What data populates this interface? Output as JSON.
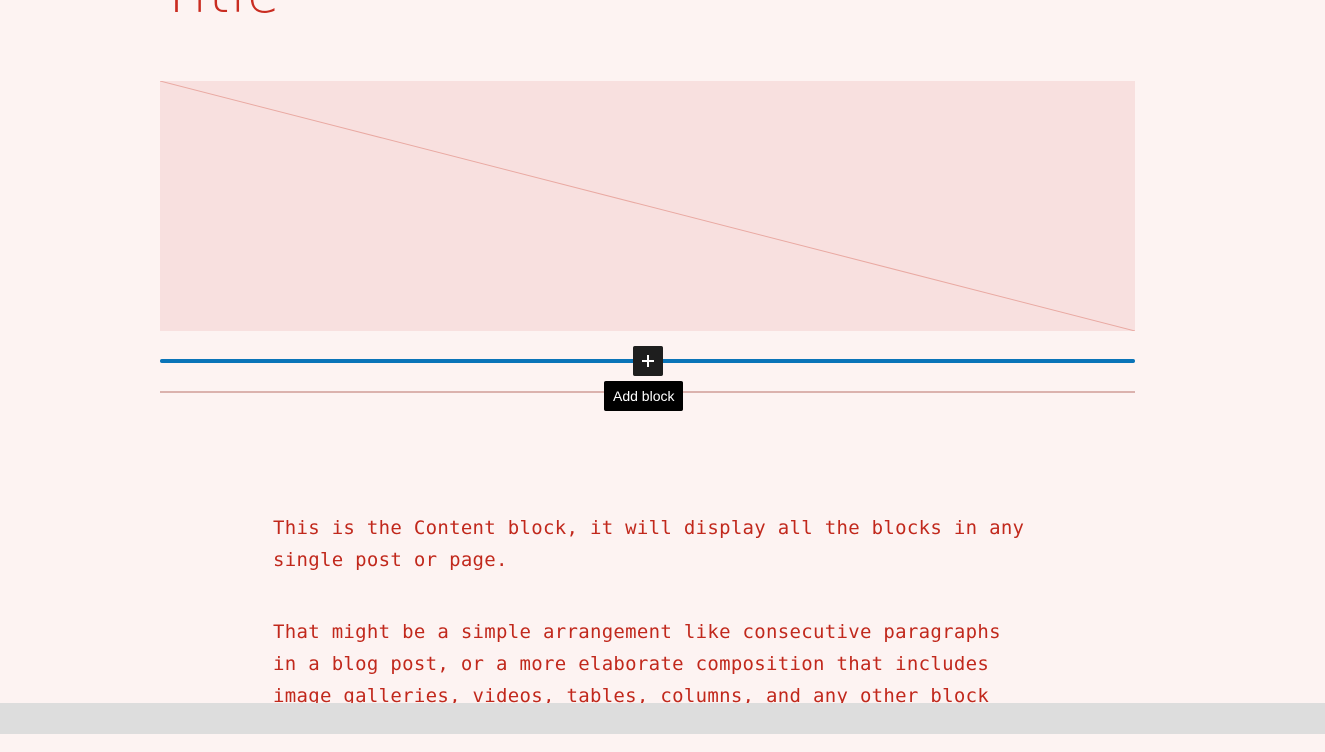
{
  "post": {
    "title": "Title"
  },
  "featured_image": {
    "placeholder": "image-placeholder"
  },
  "inserter": {
    "add_icon": "plus-icon",
    "tooltip": "Add block"
  },
  "content": {
    "paragraphs": [
      "This is the Content block, it will display all the blocks in any single post or page.",
      "That might be a simple arrangement like consecutive paragraphs in a blog post, or a more elaborate composition that includes image galleries, videos, tables, columns, and any other block"
    ]
  },
  "colors": {
    "background": "#fdf3f2",
    "text": "#c1281c",
    "inserter_line": "#0a74b8",
    "placeholder_bg": "#f8e0df"
  }
}
